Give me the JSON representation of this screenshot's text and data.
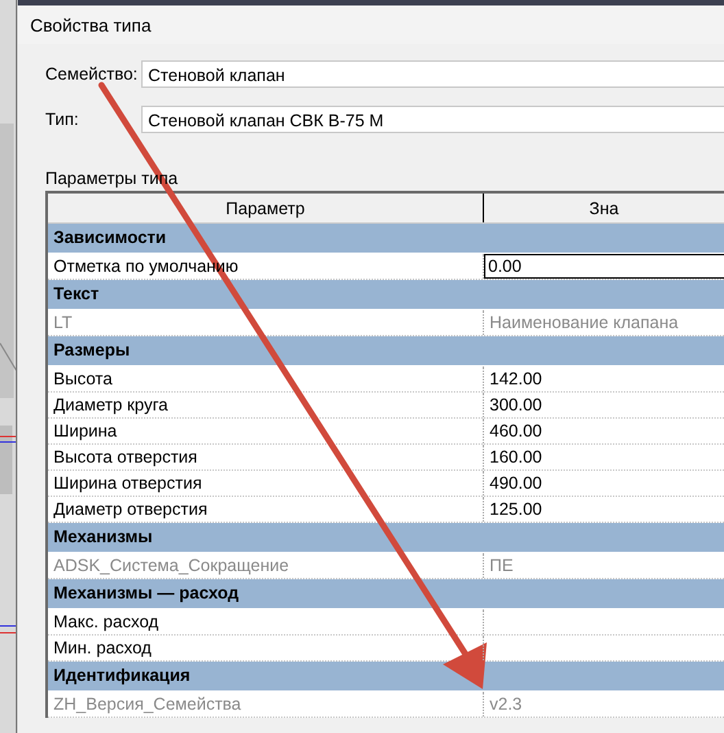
{
  "window": {
    "title": "Свойства типа"
  },
  "family": {
    "label": "Семейство:",
    "value": "Стеновой клапан"
  },
  "type": {
    "label": "Тип:",
    "value": "Стеновой клапан СВК В-75 М"
  },
  "section_title": "Параметры типа",
  "table": {
    "columns": [
      "Параметр",
      "Зна"
    ],
    "rows": [
      {
        "kind": "group",
        "label": "Зависимости"
      },
      {
        "kind": "param",
        "label": "Отметка по умолчанию",
        "value": "0.00",
        "readonly": false,
        "editing": true
      },
      {
        "kind": "group",
        "label": "Текст"
      },
      {
        "kind": "param",
        "label": "LT",
        "value": "Наименование клапана",
        "readonly": true,
        "editing": false
      },
      {
        "kind": "group",
        "label": "Размеры"
      },
      {
        "kind": "param",
        "label": "Высота",
        "value": "142.00",
        "readonly": false,
        "editing": false
      },
      {
        "kind": "param",
        "label": "Диаметр круга",
        "value": "300.00",
        "readonly": false,
        "editing": false
      },
      {
        "kind": "param",
        "label": "Ширина",
        "value": "460.00",
        "readonly": false,
        "editing": false
      },
      {
        "kind": "param",
        "label": "Высота отверстия",
        "value": "160.00",
        "readonly": false,
        "editing": false
      },
      {
        "kind": "param",
        "label": "Ширина отверстия",
        "value": "490.00",
        "readonly": false,
        "editing": false
      },
      {
        "kind": "param",
        "label": "Диаметр отверстия",
        "value": "125.00",
        "readonly": false,
        "editing": false
      },
      {
        "kind": "group",
        "label": "Механизмы"
      },
      {
        "kind": "param",
        "label": "ADSK_Система_Сокращение",
        "value": "ПЕ",
        "readonly": true,
        "editing": false
      },
      {
        "kind": "group",
        "label": "Механизмы — расход"
      },
      {
        "kind": "param",
        "label": "Макс. расход",
        "readonly": false,
        "editing": false
      },
      {
        "kind": "param",
        "label": "Мин. расход",
        "readonly": false,
        "editing": false
      },
      {
        "kind": "group",
        "label": "Идентификация"
      },
      {
        "kind": "param",
        "label": "ZH_Версия_Семейства",
        "value": "v2.3",
        "readonly": true,
        "editing": false
      }
    ]
  }
}
